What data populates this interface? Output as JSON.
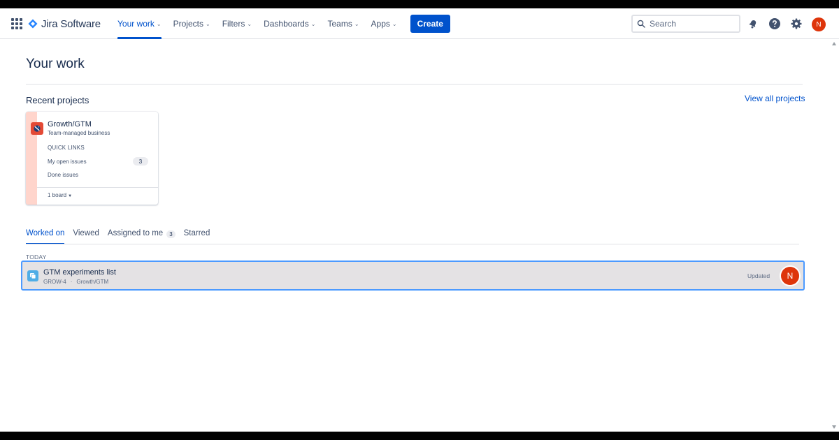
{
  "app": {
    "title": "Jira Software",
    "brand_color": "#0052cc"
  },
  "nav": {
    "items": [
      {
        "label": "Your work",
        "active": true
      },
      {
        "label": "Projects"
      },
      {
        "label": "Filters"
      },
      {
        "label": "Dashboards"
      },
      {
        "label": "Teams"
      },
      {
        "label": "Apps"
      }
    ],
    "create_label": "Create",
    "search_placeholder": "Search",
    "icons": [
      "app-switcher-icon",
      "notifications-icon",
      "help-icon",
      "settings-icon"
    ],
    "user_initial": "N"
  },
  "page": {
    "title": "Your work"
  },
  "recent_projects": {
    "heading": "Recent projects",
    "view_all_label": "View all projects",
    "card": {
      "name": "Growth/GTM",
      "type": "Team-managed business",
      "quick_links_heading": "QUICK LINKS",
      "links": [
        {
          "label": "My open issues",
          "count": "3"
        },
        {
          "label": "Done issues"
        }
      ],
      "boards_label": "1 board"
    }
  },
  "tabs": {
    "items": [
      {
        "label": "Worked on",
        "active": true
      },
      {
        "label": "Viewed"
      },
      {
        "label": "Assigned to me",
        "count": "3"
      },
      {
        "label": "Starred"
      }
    ]
  },
  "activity": {
    "group_label": "TODAY",
    "items": [
      {
        "title": "GTM experiments list",
        "key": "GROW-4",
        "project": "Growth/GTM",
        "status": "Updated",
        "avatar_initial": "N"
      }
    ]
  }
}
